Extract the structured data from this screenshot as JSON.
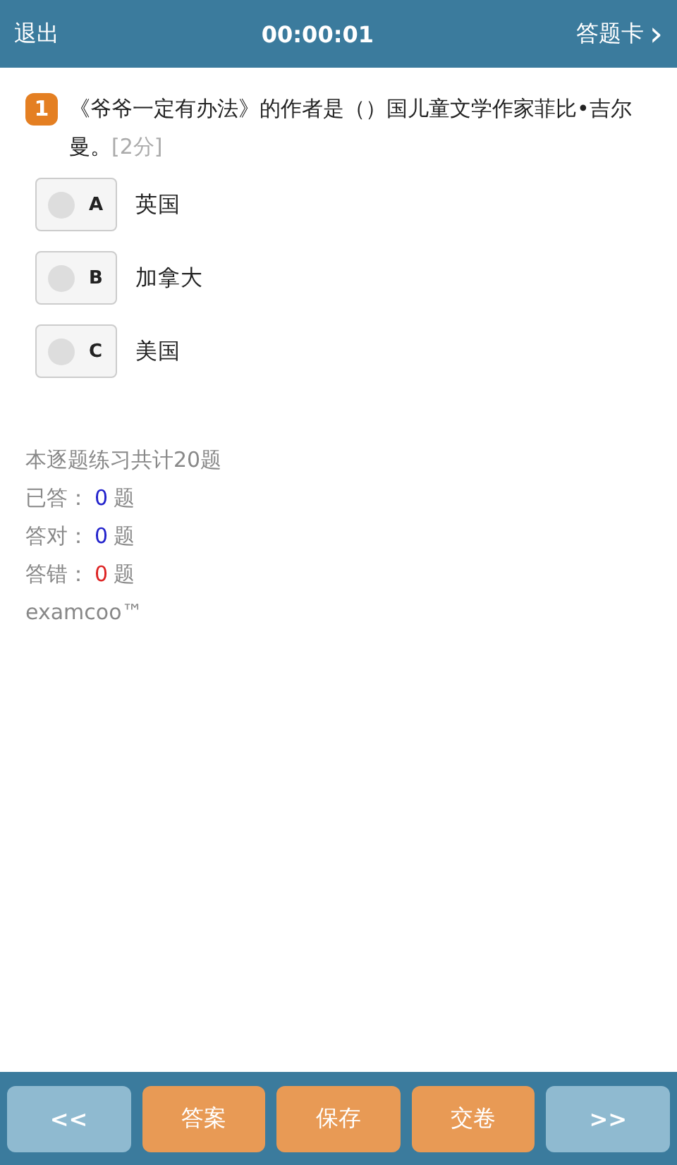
{
  "header": {
    "exit": "退出",
    "timer": "00:00:01",
    "answer_card": "答题卡",
    "chevron": "›"
  },
  "question": {
    "number": "1",
    "text": "《爷爷一定有办法》的作者是（）国儿童文学作家菲比•吉尔曼。",
    "score": "[2分]"
  },
  "options": [
    {
      "letter": "A",
      "text": "英国",
      "selected": false
    },
    {
      "letter": "B",
      "text": "加拿大",
      "selected": false
    },
    {
      "letter": "C",
      "text": "美国",
      "selected": false
    }
  ],
  "summary": {
    "total": "本逐题练习共计20题",
    "stats": [
      {
        "label": "已答：",
        "value": "0",
        "unit": "题",
        "color": "#2222cc"
      },
      {
        "label": "答对：",
        "value": "0",
        "unit": "题",
        "color": "#2222cc"
      },
      {
        "label": "答错：",
        "value": "0",
        "unit": "题",
        "color": "#dd2222"
      }
    ],
    "brand": "examcoo™"
  },
  "footer": [
    {
      "label": "<<",
      "disabled": true
    },
    {
      "label": "答案",
      "disabled": false
    },
    {
      "label": "保存",
      "disabled": false
    },
    {
      "label": "交卷",
      "disabled": false
    },
    {
      "label": ">>",
      "disabled": true
    }
  ]
}
